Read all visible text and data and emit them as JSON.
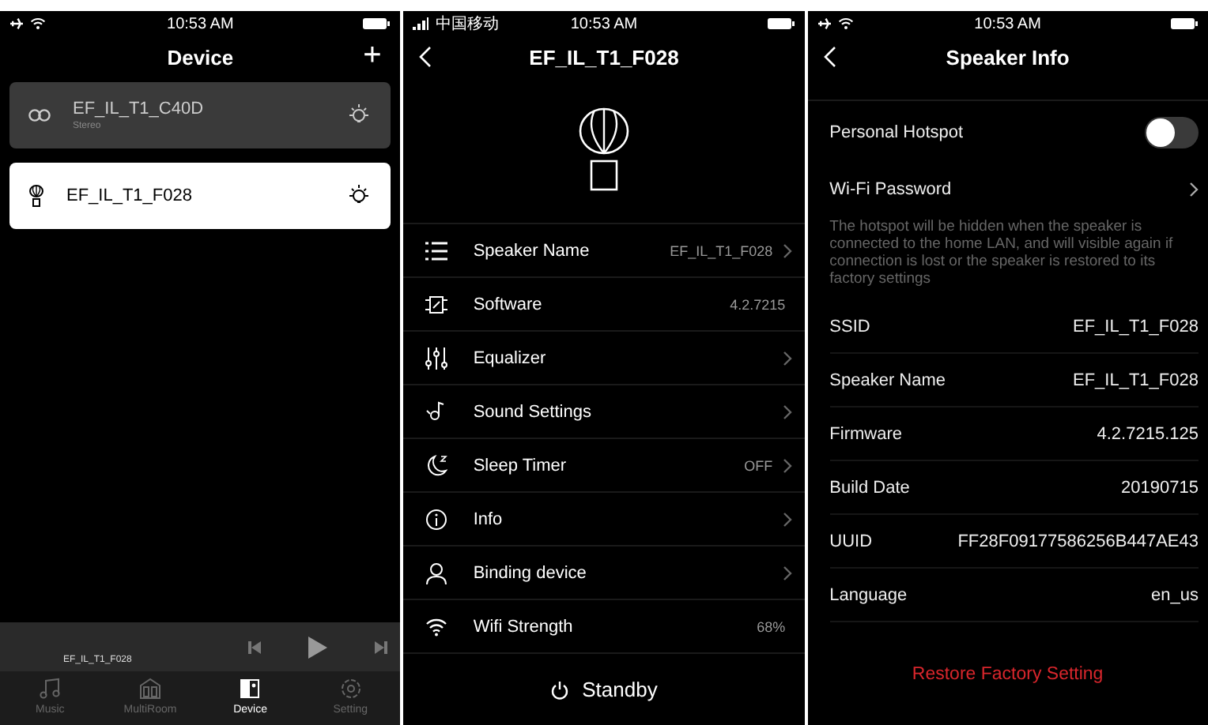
{
  "device_screen": {
    "status_bar": {
      "time": "10:53 AM"
    },
    "title": "Device",
    "add_button": "+",
    "devices": [
      {
        "name": "EF_IL_T1_C40D",
        "subtitle": "Stereo",
        "kind": "stereo",
        "selected": false
      },
      {
        "name": "EF_IL_T1_F028",
        "kind": "single",
        "selected": true
      }
    ],
    "mini_player": {
      "track": "EF_IL_T1_F028"
    },
    "tab_bar": [
      {
        "label": "Music",
        "selected": false
      },
      {
        "label": "MultiRoom",
        "selected": false
      },
      {
        "label": "Device",
        "selected": true
      },
      {
        "label": "Setting",
        "selected": false
      }
    ]
  },
  "speaker_screen": {
    "status_bar": {
      "carrier": "中国移动",
      "time": "10:53 AM"
    },
    "title": "EF_IL_T1_F028",
    "rows": [
      {
        "label": "Speaker Name",
        "value": "EF_IL_T1_F028",
        "chevron": true
      },
      {
        "label": "Software",
        "value": "4.2.7215",
        "chevron": false
      },
      {
        "label": "Equalizer",
        "chevron": true
      },
      {
        "label": "Sound Settings",
        "chevron": true
      },
      {
        "label": "Sleep Timer",
        "value": "OFF",
        "chevron": true
      },
      {
        "label": "Info",
        "chevron": true
      },
      {
        "label": "Binding device",
        "chevron": true
      },
      {
        "label": "Wifi Strength",
        "value": "68%",
        "chevron": false
      }
    ],
    "standby_button": "Standby"
  },
  "info_screen": {
    "status_bar": {
      "time": "10:53 AM"
    },
    "title": "Speaker Info",
    "settings": [
      {
        "kind": "toggle",
        "label": "Personal Hotspot",
        "on": false
      },
      {
        "kind": "link",
        "label": "Wi-Fi Password"
      },
      {
        "kind": "note",
        "text": "The hotspot will be hidden when the speaker is connected to the home LAN, and will visible again if connection is lost or the speaker is restored to its factory settings"
      }
    ],
    "details": [
      {
        "label": "SSID",
        "value": "EF_IL_T1_F028"
      },
      {
        "label": "Speaker Name",
        "value": "EF_IL_T1_F028"
      },
      {
        "label": "Firmware",
        "value": "4.2.7215.125"
      },
      {
        "label": "Build Date",
        "value": "20190715"
      },
      {
        "label": "UUID",
        "value": "FF28F09177586256B447AE43"
      },
      {
        "label": "Language",
        "value": "en_us"
      }
    ],
    "restore_button": "Restore Factory Setting"
  }
}
